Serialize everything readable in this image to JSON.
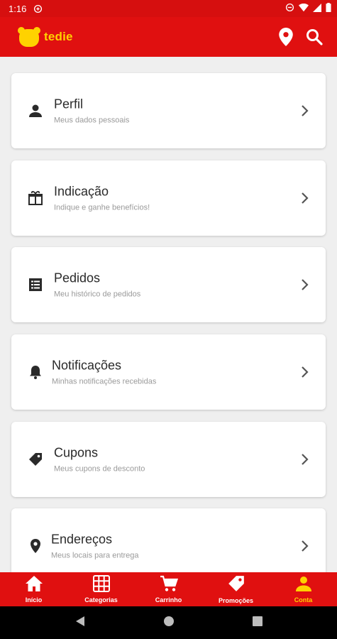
{
  "status_bar": {
    "time": "1:16"
  },
  "app_bar": {
    "brand_name": "tedie"
  },
  "menu": [
    {
      "title": "Perfil",
      "subtitle": "Meus dados pessoais",
      "icon": "person-icon"
    },
    {
      "title": "Indicação",
      "subtitle": "Indique e ganhe benefícios!",
      "icon": "gift-icon"
    },
    {
      "title": "Pedidos",
      "subtitle": "Meu histórico de pedidos",
      "icon": "list-icon"
    },
    {
      "title": "Notificações",
      "subtitle": "Minhas notificações recebidas",
      "icon": "bell-icon"
    },
    {
      "title": "Cupons",
      "subtitle": "Meus cupons de desconto",
      "icon": "tag-icon"
    },
    {
      "title": "Endereços",
      "subtitle": "Meus locais para entrega",
      "icon": "location-pin-icon"
    }
  ],
  "bottom_nav": [
    {
      "label": "Início",
      "icon": "home-icon",
      "active": false
    },
    {
      "label": "Categorias",
      "icon": "grid-icon",
      "active": false
    },
    {
      "label": "Carrinho",
      "icon": "cart-icon",
      "active": false
    },
    {
      "label": "Promoções",
      "icon": "tag-icon",
      "active": false
    },
    {
      "label": "Conta",
      "icon": "person-icon",
      "active": true
    }
  ],
  "colors": {
    "brand_red": "#e01010",
    "brand_yellow": "#ffd200",
    "background": "#efefef"
  }
}
